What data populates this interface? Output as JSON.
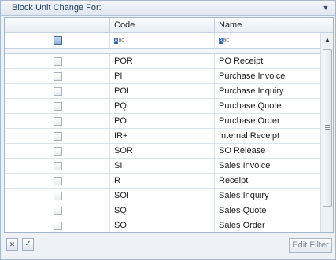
{
  "panel": {
    "title": "Block Unit Change For:",
    "collapse_icon": "chevron-down-icon"
  },
  "grid": {
    "columns": [
      "",
      "Code",
      "Name"
    ],
    "filter_row": {
      "select_all_checked": false,
      "code_filter_icon": "abc-text-filter-icon",
      "name_filter_icon": "abc-text-filter-icon"
    },
    "rows": [
      {
        "checked": false,
        "code": "POR",
        "name": "PO Receipt"
      },
      {
        "checked": false,
        "code": "PI",
        "name": "Purchase Invoice"
      },
      {
        "checked": false,
        "code": "POI",
        "name": "Purchase Inquiry"
      },
      {
        "checked": false,
        "code": "PQ",
        "name": "Purchase Quote"
      },
      {
        "checked": false,
        "code": "PO",
        "name": "Purchase Order"
      },
      {
        "checked": false,
        "code": "IR+",
        "name": "Internal Receipt"
      },
      {
        "checked": false,
        "code": "SOR",
        "name": "SO Release"
      },
      {
        "checked": false,
        "code": "SI",
        "name": "Sales Invoice"
      },
      {
        "checked": false,
        "code": "R",
        "name": "Receipt"
      },
      {
        "checked": false,
        "code": "SOI",
        "name": "Sales Inquiry"
      },
      {
        "checked": false,
        "code": "SQ",
        "name": "Sales Quote"
      },
      {
        "checked": false,
        "code": "SO",
        "name": "Sales Order"
      }
    ]
  },
  "footer": {
    "clear_icon": "close-icon",
    "apply_icon": "check-icon",
    "edit_filter_label": "Edit Filter"
  }
}
